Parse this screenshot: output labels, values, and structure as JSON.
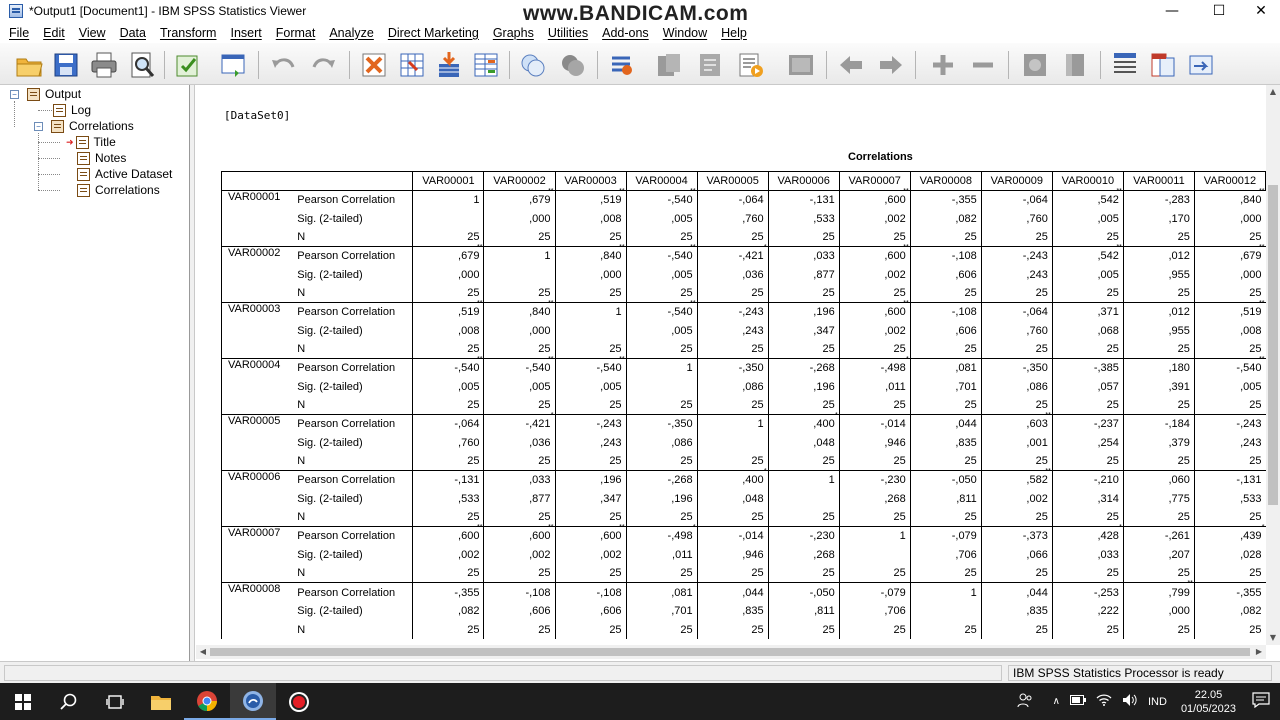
{
  "window": {
    "title": "*Output1 [Document1] - IBM SPSS Statistics Viewer",
    "watermark": "www.BANDICAM.com",
    "minimize": "—",
    "maximize": "☐",
    "close": "✕"
  },
  "menu": [
    "File",
    "Edit",
    "View",
    "Data",
    "Transform",
    "Insert",
    "Format",
    "Analyze",
    "Direct Marketing",
    "Graphs",
    "Utilities",
    "Add-ons",
    "Window",
    "Help"
  ],
  "toolbar_icons": [
    "open-icon",
    "save-icon",
    "print-icon",
    "print-preview-icon",
    "export-icon",
    "recall-dialog-icon",
    "undo-icon",
    "redo-icon",
    "goto-data-icon",
    "goto-case-icon",
    "goto-variable-icon",
    "variables-icon",
    "show-all-icon",
    "designated-window-icon",
    "select-output-icon",
    "run-script-icon",
    "insert-heading-icon",
    "insert-title-icon",
    "insert-text-icon",
    "previous-icon",
    "next-icon",
    "expand-icon",
    "collapse-icon",
    "show-icon",
    "hide-icon",
    "pivot-icon",
    "insert-table-icon",
    "create-edit-icon",
    "designate-icon"
  ],
  "nav_tree": {
    "output": "Output",
    "log": "Log",
    "correlations": "Correlations",
    "title": "Title",
    "notes": "Notes",
    "active_dataset": "Active Dataset",
    "correlations_table": "Correlations"
  },
  "content": {
    "dataset": "[DataSet0]",
    "table_title": "Correlations",
    "columns": [
      "VAR00001",
      "VAR00002",
      "VAR00003",
      "VAR00004",
      "VAR00005",
      "VAR00006",
      "VAR00007",
      "VAR00008",
      "VAR00009",
      "VAR00010",
      "VAR00011",
      "VAR00012"
    ],
    "stat_labels": [
      "Pearson Correlation",
      "Sig. (2-tailed)",
      "N"
    ],
    "rows": [
      {
        "name": "VAR00001",
        "r": [
          "1",
          ",679**",
          ",519**",
          "-,540**",
          "-,064",
          "-,131",
          ",600**",
          "-,355",
          "-,064",
          ",542**",
          "-,283",
          ",840**"
        ],
        "sig": [
          "",
          ",000",
          ",008",
          ",005",
          ",760",
          ",533",
          ",002",
          ",082",
          ",760",
          ",005",
          ",170",
          ",000"
        ],
        "n": [
          "25",
          "25",
          "25",
          "25",
          "25",
          "25",
          "25",
          "25",
          "25",
          "25",
          "25",
          "25"
        ]
      },
      {
        "name": "VAR00002",
        "r": [
          ",679**",
          "1",
          ",840**",
          "-,540**",
          "-,421*",
          ",033",
          ",600**",
          "-,108",
          "-,243",
          ",542**",
          ",012",
          ",679**"
        ],
        "sig": [
          ",000",
          "",
          ",000",
          ",005",
          ",036",
          ",877",
          ",002",
          ",606",
          ",243",
          ",005",
          ",955",
          ",000"
        ],
        "n": [
          "25",
          "25",
          "25",
          "25",
          "25",
          "25",
          "25",
          "25",
          "25",
          "25",
          "25",
          "25"
        ]
      },
      {
        "name": "VAR00003",
        "r": [
          ",519**",
          ",840**",
          "1",
          "-,540**",
          "-,243",
          ",196",
          ",600**",
          "-,108",
          "-,064",
          ",371",
          ",012",
          ",519**"
        ],
        "sig": [
          ",008",
          ",000",
          "",
          ",005",
          ",243",
          ",347",
          ",002",
          ",606",
          ",760",
          ",068",
          ",955",
          ",008"
        ],
        "n": [
          "25",
          "25",
          "25",
          "25",
          "25",
          "25",
          "25",
          "25",
          "25",
          "25",
          "25",
          "25"
        ]
      },
      {
        "name": "VAR00004",
        "r": [
          "-,540**",
          "-,540**",
          "-,540**",
          "1",
          "-,350",
          "-,268",
          "-,498*",
          ",081",
          "-,350",
          "-,385",
          ",180",
          "-,540**"
        ],
        "sig": [
          ",005",
          ",005",
          ",005",
          "",
          ",086",
          ",196",
          ",011",
          ",701",
          ",086",
          ",057",
          ",391",
          ",005"
        ],
        "n": [
          "25",
          "25",
          "25",
          "25",
          "25",
          "25",
          "25",
          "25",
          "25",
          "25",
          "25",
          "25"
        ]
      },
      {
        "name": "VAR00005",
        "r": [
          "-,064",
          "-,421*",
          "-,243",
          "-,350",
          "1",
          ",400*",
          "-,014",
          ",044",
          ",603**",
          "-,237",
          "-,184",
          "-,243"
        ],
        "sig": [
          ",760",
          ",036",
          ",243",
          ",086",
          "",
          ",048",
          ",946",
          ",835",
          ",001",
          ",254",
          ",379",
          ",243"
        ],
        "n": [
          "25",
          "25",
          "25",
          "25",
          "25",
          "25",
          "25",
          "25",
          "25",
          "25",
          "25",
          "25"
        ]
      },
      {
        "name": "VAR00006",
        "r": [
          "-,131",
          ",033",
          ",196",
          "-,268",
          ",400*",
          "1",
          "-,230",
          "-,050",
          ",582**",
          "-,210",
          ",060",
          "-,131"
        ],
        "sig": [
          ",533",
          ",877",
          ",347",
          ",196",
          ",048",
          "",
          ",268",
          ",811",
          ",002",
          ",314",
          ",775",
          ",533"
        ],
        "n": [
          "25",
          "25",
          "25",
          "25",
          "25",
          "25",
          "25",
          "25",
          "25",
          "25",
          "25",
          "25"
        ]
      },
      {
        "name": "VAR00007",
        "r": [
          ",600**",
          ",600**",
          ",600**",
          "-,498*",
          "-,014",
          "-,230",
          "1",
          "-,079",
          "-,373",
          ",428*",
          "-,261",
          ",439*"
        ],
        "sig": [
          ",002",
          ",002",
          ",002",
          ",011",
          ",946",
          ",268",
          "",
          ",706",
          ",066",
          ",033",
          ",207",
          ",028"
        ],
        "n": [
          "25",
          "25",
          "25",
          "25",
          "25",
          "25",
          "25",
          "25",
          "25",
          "25",
          "25",
          "25"
        ]
      },
      {
        "name": "VAR00008",
        "r": [
          "-,355",
          "-,108",
          "-,108",
          ",081",
          ",044",
          "-,050",
          "-,079",
          "1",
          ",044",
          "-,253",
          ",799**",
          "-,355"
        ],
        "sig": [
          ",082",
          ",606",
          ",606",
          ",701",
          ",835",
          ",811",
          ",706",
          "",
          ",835",
          ",222",
          ",000",
          ",082"
        ],
        "n": [
          "25",
          "25",
          "25",
          "25",
          "25",
          "25",
          "25",
          "25",
          "25",
          "25",
          "25",
          "25"
        ]
      }
    ]
  },
  "status": {
    "processor": "IBM SPSS Statistics Processor is ready"
  },
  "taskbar": {
    "language": "IND",
    "time": "22.05",
    "date": "01/05/2023"
  }
}
